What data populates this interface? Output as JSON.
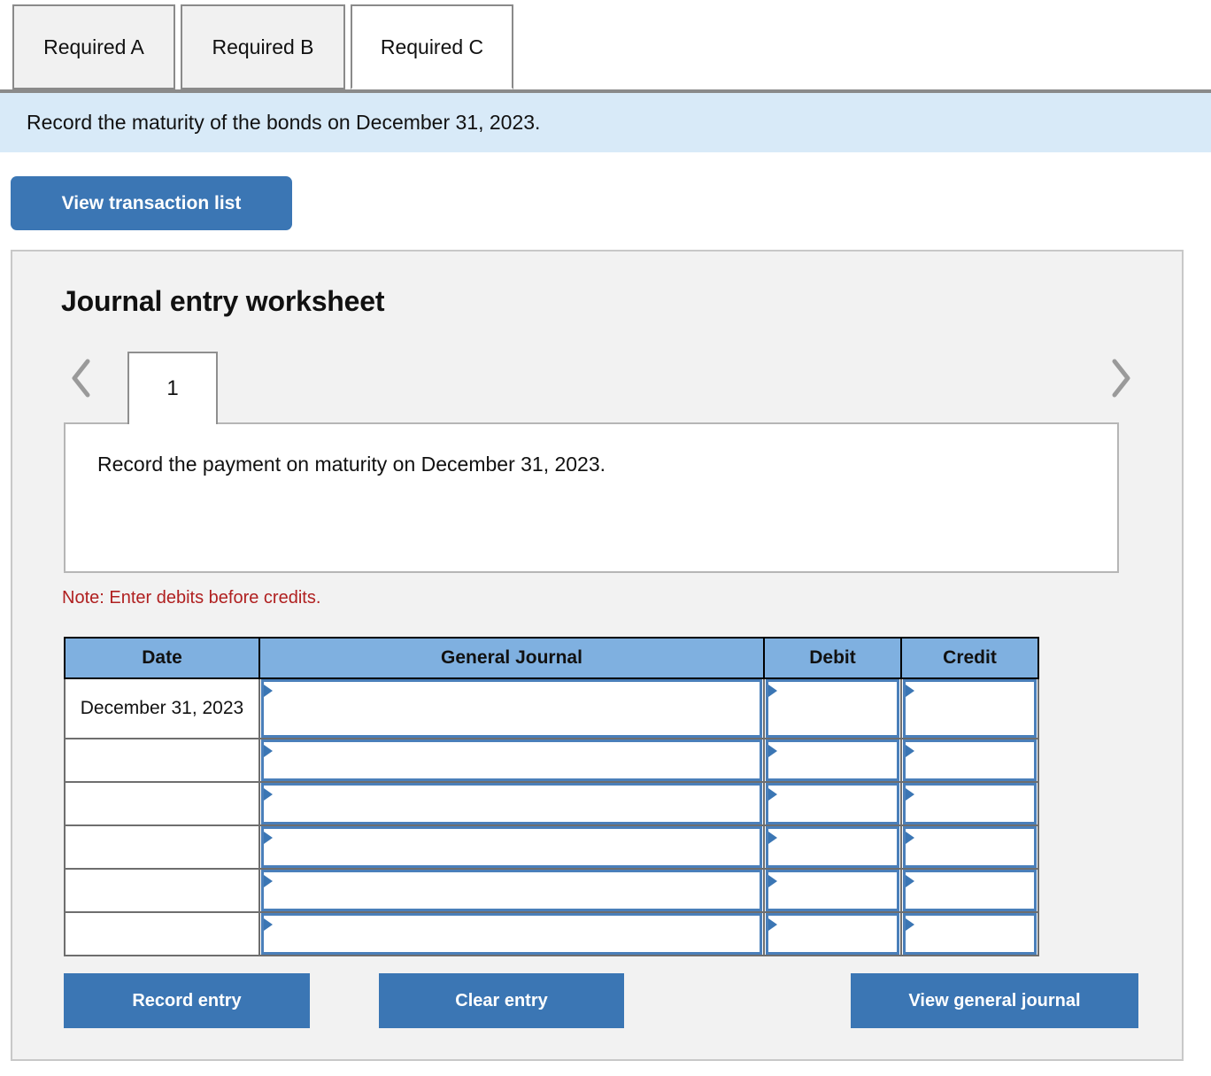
{
  "requirement_tabs": [
    {
      "label": "Required A",
      "active": false
    },
    {
      "label": "Required B",
      "active": false
    },
    {
      "label": "Required C",
      "active": true
    }
  ],
  "info_bar": {
    "text": "Record the maturity of the bonds on December 31, 2023."
  },
  "toolbar": {
    "view_transaction_list_label": "View transaction list"
  },
  "worksheet": {
    "title": "Journal entry worksheet",
    "prev_icon": "chevron-left-icon",
    "next_icon": "chevron-right-icon",
    "page_tabs": [
      {
        "label": "1",
        "active": true
      }
    ],
    "prompt": "Record the payment on maturity on December 31, 2023.",
    "note": "Note: Enter debits before credits."
  },
  "journal_table": {
    "headers": [
      "Date",
      "General Journal",
      "Debit",
      "Credit"
    ],
    "rows": [
      {
        "date": "December 31, 2023",
        "general_journal": "",
        "debit": "",
        "credit": ""
      },
      {
        "date": "",
        "general_journal": "",
        "debit": "",
        "credit": ""
      },
      {
        "date": "",
        "general_journal": "",
        "debit": "",
        "credit": ""
      },
      {
        "date": "",
        "general_journal": "",
        "debit": "",
        "credit": ""
      },
      {
        "date": "",
        "general_journal": "",
        "debit": "",
        "credit": ""
      },
      {
        "date": "",
        "general_journal": "",
        "debit": "",
        "credit": ""
      }
    ]
  },
  "footer": {
    "record_entry_label": "Record entry",
    "clear_entry_label": "Clear entry",
    "view_general_journal_label": "View general journal"
  },
  "colors": {
    "accent_blue": "#3b76b4",
    "info_bar_blue": "#d8eaf8",
    "table_header_blue": "#7fb0e0",
    "panel_gray": "#f2f2f2",
    "note_red": "#b02020"
  }
}
